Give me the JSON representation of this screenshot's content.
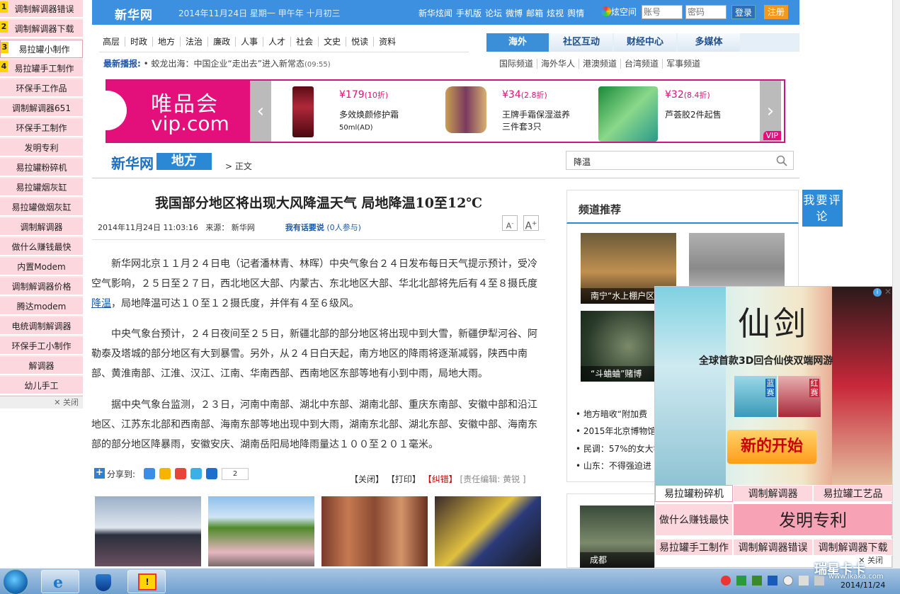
{
  "left_rail": {
    "items": [
      "调制解调器错误",
      "调制解调器下载",
      "易拉罐小制作",
      "易拉罐手工制作",
      "环保手工作品",
      "调制解调器651",
      "环保手工制作",
      "发明专利",
      "易拉罐粉碎机",
      "易拉罐烟灰缸",
      "易拉罐做烟灰缸",
      "调制解调器",
      "做什么赚钱最快",
      "内置Modem",
      "调制解调器价格",
      "腾达modem",
      "电统调制解调器",
      "环保手工小制作",
      "解调器",
      "幼儿手工"
    ],
    "numbers": [
      "1",
      "2",
      "3",
      "4"
    ],
    "close": "关闭"
  },
  "topbar": {
    "logo": "新华网",
    "date": "2014年11月24日  星期一    甲午年  十月初三",
    "links": [
      "新华炫闻",
      "手机版",
      "论坛",
      "微博",
      "邮箱",
      "炫视",
      "舆情"
    ],
    "qzone": "炫空间",
    "account_placeholder": "账号",
    "password_placeholder": "密码",
    "login": "登录",
    "register": "注册"
  },
  "nav": {
    "items": [
      "高层",
      "时政",
      "地方",
      "法治",
      "廉政",
      "人事",
      "人才",
      "社会",
      "文史",
      "悦读",
      "资料"
    ],
    "flash_label": "最新播报:",
    "flash_text": "• 蛟龙出海：中国企业“走出去”进入新常态",
    "flash_time": "(09:55)",
    "tabs": [
      "海外",
      "社区互动",
      "财经中心",
      "多媒体"
    ],
    "subtabs": [
      "国际频道",
      "海外华人",
      "港澳频道",
      "台湾频道",
      "军事频道"
    ]
  },
  "banner": {
    "brand_cn": "唯品会",
    "brand_en": "vip.com",
    "products": [
      {
        "price": "¥179",
        "discount": "(10折)",
        "name": "多效焕颜修护霜",
        "spec": "50ml(AD)"
      },
      {
        "price": "¥34",
        "discount": "(2.8折)",
        "name": "王牌手霜保湿滋养",
        "spec": "三件套3只"
      },
      {
        "price": "¥32",
        "discount": "(8.4折)",
        "name": "芦荟胶2件起售",
        "spec": ""
      }
    ],
    "badge": "VIP",
    "colors": {
      "brand": "#e30f7b"
    }
  },
  "breadcrumb": {
    "site": "新华网",
    "section": "地方",
    "current": "> 正文",
    "search_value": "降温"
  },
  "article": {
    "title": "我国部分地区将出现大风降温天气  局地降温10至12℃",
    "datetime": "2014年11月24日 11:03:16",
    "source": "来源：  新华网",
    "comment_link": "我有话要说",
    "comment_count": "(0人参与)",
    "font_small": "A",
    "font_large": "A",
    "p1_a": "新华网北京１１月２４日电（记者潘林青、林晖）中央气象台２４日发布每日天气提示预计，受冷空气影响，２５日至２７日，西北地区大部、内蒙古、东北地区大部、华北北部将先后有４至８摄氏度",
    "p1_link": "降温",
    "p1_b": "，局地降温可达１０至１２摄氏度，并伴有４至６级风。",
    "p2": "中央气象台预计，２４日夜间至２５日，新疆北部的部分地区将出现中到大雪，新疆伊犁河谷、阿勒泰及塔城的部分地区有大到暴雪。另外，从２４日白天起，南方地区的降雨将逐渐减弱，陕西中南部、黄淮南部、江淮、汉江、江南、华南西部、西南地区东部等地有小到中雨，局地大雨。",
    "p3": "据中央气象台监测，２３日，河南中南部、湖北中东部、湖南北部、重庆东南部、安徽中部和沿江地区、江苏东北部和西南部、海南东部等地出现中到大雨，湖南东北部、湖北东部、安徽中部、海南东部的部分地区降暴雨，安徽安庆、湖南岳阳局地降雨量达１００至２０１毫米。",
    "share_label": "分享到:",
    "share_count": "2",
    "close": "【关闭】",
    "print": "【打印】",
    "error": "【纠错】",
    "editor": "[责任编辑:  黄锐 ]"
  },
  "right": {
    "title": "频道推荐",
    "comment_btn": "我要评论",
    "captions": [
      "南宁“水上棚户区",
      "“斗蛐蛐”赌博",
      "成都"
    ],
    "list": [
      "• 地方暗收“附加费",
      "• 2015年北京博物馆",
      "• 民调：57%的女大学",
      "• 山东：不得强迫进"
    ]
  },
  "popup": {
    "game_title": "仙剑",
    "slogan": "全球首款3D回合仙侠双端网游",
    "tag_blue": "蓝赛",
    "tag_red": "红赛",
    "cta": "新的开始",
    "links": [
      "易拉罐粉碎机",
      "调制解调器",
      "易拉罐工艺品",
      "做什么赚钱最快",
      "发明专利",
      "易拉罐手工制作",
      "调制解调器错误",
      "调制解调器下载"
    ],
    "close": "关闭"
  },
  "taskbar": {
    "clock": "2014/11/24",
    "watermark": "瑞星卡卡",
    "watermark_url": "www.ikaka.com"
  }
}
